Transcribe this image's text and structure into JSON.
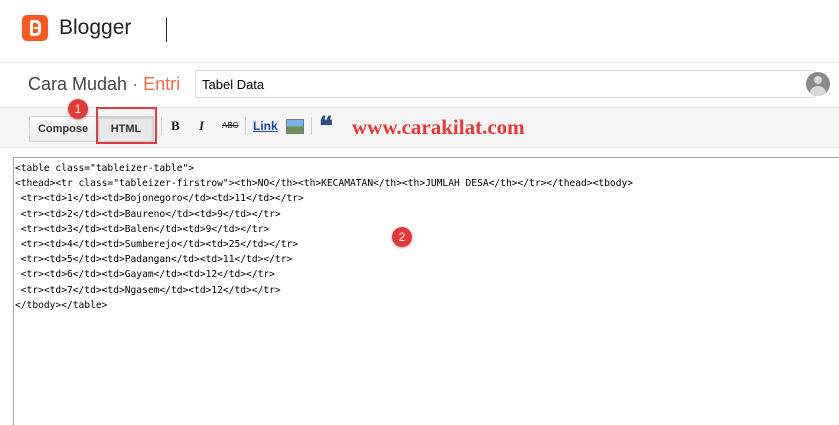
{
  "app": {
    "name": "Blogger"
  },
  "post": {
    "blog_name": "Cara Mudah",
    "separator": "·",
    "section": "Entri",
    "title_value": "Tabel Data"
  },
  "toolbar": {
    "compose_label": "Compose",
    "html_label": "HTML",
    "bold_label": "B",
    "italic_label": "I",
    "strike_label": "ABC",
    "link_label": "Link",
    "quote_label": "❝"
  },
  "annotations": {
    "badge_1": "1",
    "badge_2": "2",
    "watermark": "www.carakilat.com"
  },
  "editor": {
    "lines": [
      "<table class=\"tableizer-table\">",
      "<thead><tr class=\"tableizer-firstrow\"><th>NO</th><th>KECAMATAN</th><th>JUMLAH DESA</th></tr></thead><tbody>",
      " <tr><td>1</td><td>Bojonegoro</td><td>11</td></tr>",
      " <tr><td>2</td><td>Baureno</td><td>9</td></tr>",
      " <tr><td>3</td><td>Balen</td><td>9</td></tr>",
      " <tr><td>4</td><td>Sumberejo</td><td>25</td></tr>",
      " <tr><td>5</td><td>Padangan</td><td>11</td></tr>",
      " <tr><td>6</td><td>Gayam</td><td>12</td></tr>",
      " <tr><td>7</td><td>Ngasem</td><td>12</td></tr>",
      "</tbody></table>"
    ]
  },
  "colors": {
    "brand": "#ff5722",
    "accent": "#ef6c45",
    "annotation_red": "#e53935"
  }
}
